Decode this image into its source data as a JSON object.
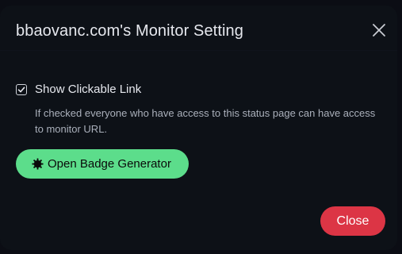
{
  "modal": {
    "title": "bbaovanc.com's Monitor Setting"
  },
  "settings": {
    "show_clickable_link": {
      "label": "Show Clickable Link",
      "checked": true,
      "help": "If checked everyone who have access to this status page can have access to monitor URL."
    }
  },
  "actions": {
    "badge_generator_label": "Open Badge Generator",
    "close_label": "Close"
  },
  "icons": {
    "close": "close-x-icon",
    "badge": "cog-icon",
    "checkbox": "check-icon"
  },
  "colors": {
    "background": "#0d1117",
    "primary": "#5cdd8b",
    "danger": "#dc3545",
    "text": "#e6e8ee",
    "muted_text": "#aab0bb"
  }
}
